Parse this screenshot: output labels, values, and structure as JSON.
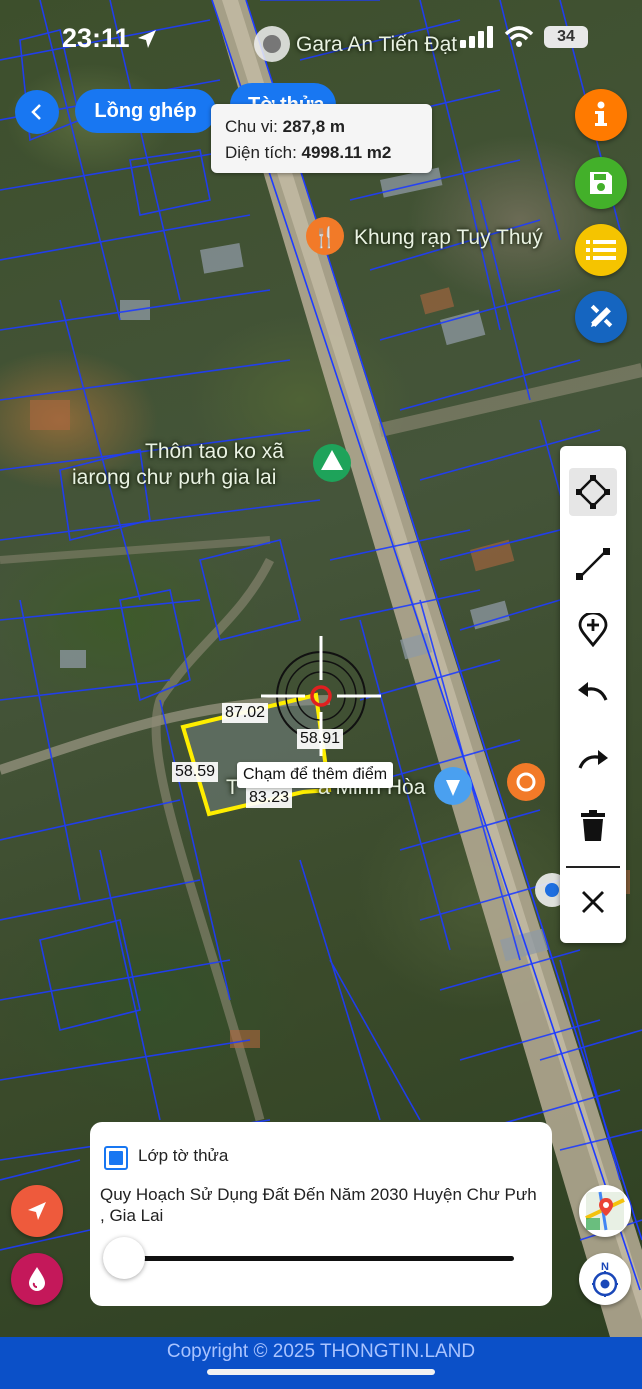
{
  "status_bar": {
    "time": "23:11",
    "battery": "34"
  },
  "header": {
    "back_icon": "chevron-left-icon",
    "combine_button": "Lồng ghép",
    "parcel_tab_label": "Tờ thửa"
  },
  "measurement": {
    "perimeter_label": "Chu vi:",
    "perimeter_value": "287,8 m",
    "area_label": "Diện tích:",
    "area_value": "4998.11 m2"
  },
  "map": {
    "places": [
      {
        "name": "Gara An Tiến Đạt"
      },
      {
        "name": "Khung rạp Tuy Thuý"
      },
      {
        "name": "Thôn tao ko xã"
      },
      {
        "name": "iarong chư pưh gia lai"
      },
      {
        "name": "T"
      },
      {
        "name": "a Minh Hòa"
      }
    ],
    "edge_lengths": [
      "87.02",
      "58.91",
      "58.59",
      "83.23"
    ],
    "tooltip": "Chạm để thêm điểm",
    "polygon_color": "#ffee00",
    "parcel_line_color": "#1e3cff"
  },
  "right_buttons": {
    "info_icon": "info-icon",
    "save_icon": "save-icon",
    "list_icon": "list-icon",
    "draw_icon": "pencil-ruler-icon",
    "colors": {
      "info": "#ff7a00",
      "save": "#43b02a",
      "list": "#f5c400",
      "draw": "#1565c0"
    }
  },
  "toolbar": {
    "tools": [
      "polygon-tool-icon",
      "line-tool-icon",
      "add-pin-icon",
      "undo-icon",
      "redo-icon",
      "delete-icon",
      "close-icon"
    ]
  },
  "layer_panel": {
    "checkbox_checked": true,
    "title": "Lớp tờ thửa",
    "description": "Quy Hoạch Sử Dụng Đất Đến Năm 2030 Huyện Chư Pưh , Gia Lai",
    "opacity": 0
  },
  "fabs": {
    "locate_icon": "navigation-arrow-icon",
    "color_icon": "water-drop-icon",
    "map_layers_icon": "map-layers-icon",
    "compass_icon": "compass-icon",
    "compass_label": "N"
  },
  "footer": {
    "copyright": "Copyright © 2025 THONGTIN.LAND"
  }
}
